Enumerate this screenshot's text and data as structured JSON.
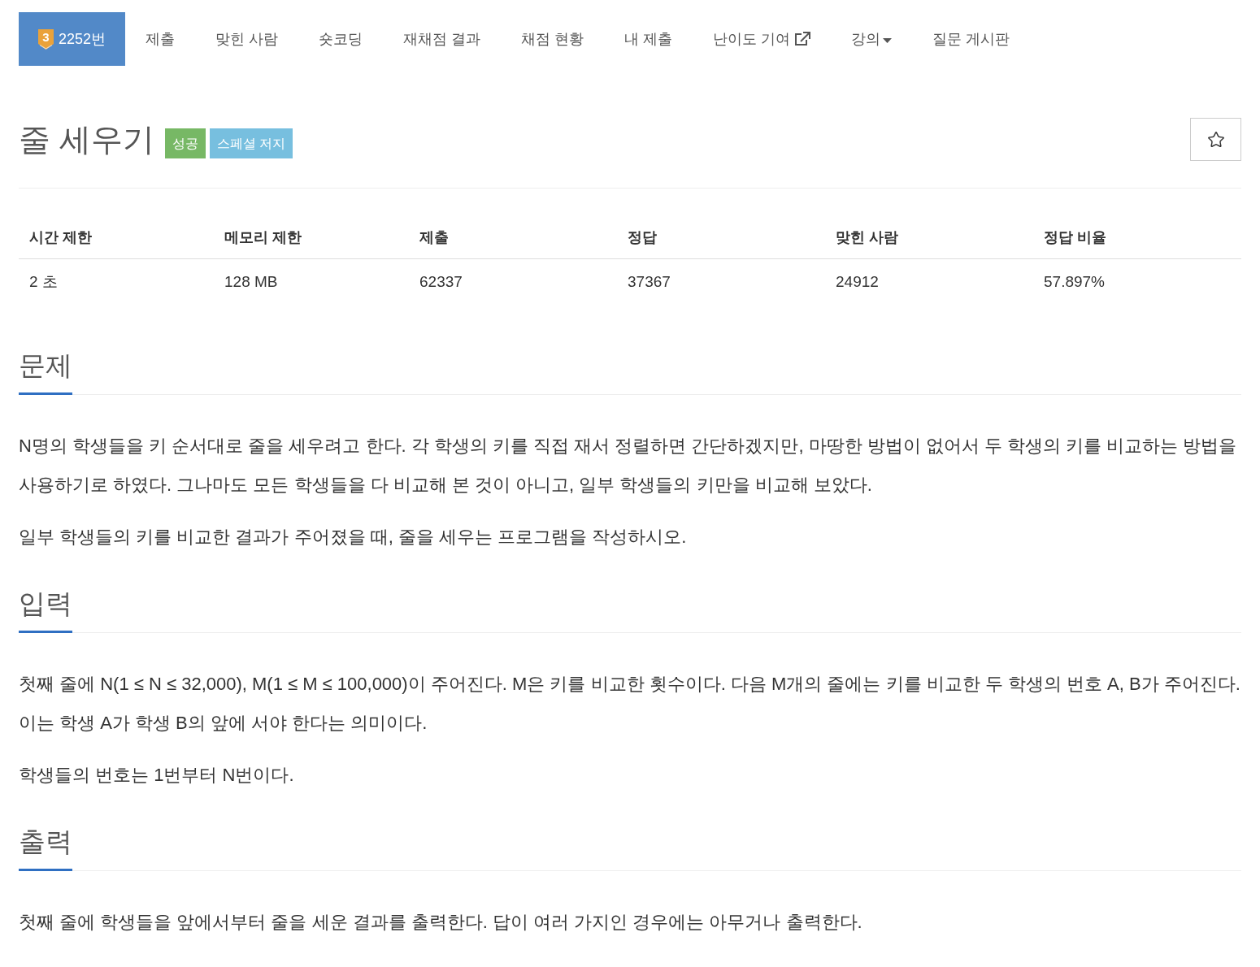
{
  "nav": {
    "tabs": [
      {
        "label": "2252번",
        "selected": true,
        "kind": "problem",
        "tier_badge": "3"
      },
      {
        "label": "제출",
        "selected": false,
        "kind": "plain"
      },
      {
        "label": "맞힌 사람",
        "selected": false,
        "kind": "plain"
      },
      {
        "label": "숏코딩",
        "selected": false,
        "kind": "plain"
      },
      {
        "label": "재채점 결과",
        "selected": false,
        "kind": "plain"
      },
      {
        "label": "채점 현황",
        "selected": false,
        "kind": "plain"
      },
      {
        "label": "내 제출",
        "selected": false,
        "kind": "plain"
      },
      {
        "label": "난이도 기여",
        "selected": false,
        "kind": "external"
      },
      {
        "label": "강의",
        "selected": false,
        "kind": "dropdown"
      },
      {
        "label": "질문 게시판",
        "selected": false,
        "kind": "plain"
      }
    ]
  },
  "problem": {
    "title": "줄 세우기",
    "badges": [
      {
        "label": "성공",
        "color": "#77b865"
      },
      {
        "label": "스페셜 저지",
        "color": "#77bfdf"
      }
    ],
    "favorite": {
      "starred": false
    }
  },
  "stats": {
    "columns": [
      "시간 제한",
      "메모리 제한",
      "제출",
      "정답",
      "맞힌 사람",
      "정답 비율"
    ],
    "rows": [
      [
        "2 초",
        "128 MB",
        "62337",
        "37367",
        "24912",
        "57.897%"
      ]
    ]
  },
  "sections": [
    {
      "heading": "문제",
      "paragraphs": [
        "N명의 학생들을 키 순서대로 줄을 세우려고 한다. 각 학생의 키를 직접 재서 정렬하면 간단하겠지만, 마땅한 방법이 없어서 두 학생의 키를 비교하는 방법을 사용하기로 하였다. 그나마도 모든 학생들을 다 비교해 본 것이 아니고, 일부 학생들의 키만을 비교해 보았다.",
        "일부 학생들의 키를 비교한 결과가 주어졌을 때, 줄을 세우는 프로그램을 작성하시오."
      ]
    },
    {
      "heading": "입력",
      "paragraphs": [
        "첫째 줄에 N(1 ≤ N ≤ 32,000), M(1 ≤ M ≤ 100,000)이 주어진다. M은 키를 비교한 횟수이다. 다음 M개의 줄에는 키를 비교한 두 학생의 번호 A, B가 주어진다. 이는 학생 A가 학생 B의 앞에 서야 한다는 의미이다.",
        "학생들의 번호는 1번부터 N번이다."
      ]
    },
    {
      "heading": "출력",
      "paragraphs": [
        "첫째 줄에 학생들을 앞에서부터 줄을 세운 결과를 출력한다. 답이 여러 가지인 경우에는 아무거나 출력한다."
      ]
    }
  ]
}
